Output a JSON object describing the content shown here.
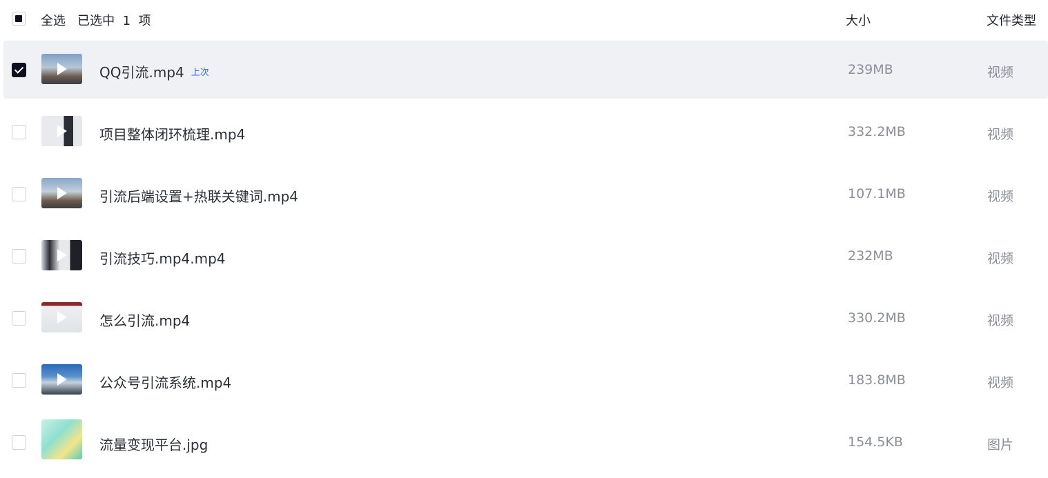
{
  "header": {
    "select_all_label": "全选   已选中  1  项",
    "size_column": "大小",
    "type_column": "文件类型"
  },
  "files": [
    {
      "name": "QQ引流.mp4",
      "tag": "上次",
      "size": "239MB",
      "type": "视频",
      "selected": true,
      "thumb_icon": "video-thumbnail"
    },
    {
      "name": "项目整体闭环梳理.mp4",
      "size": "332.2MB",
      "type": "视频",
      "selected": false,
      "thumb_icon": "video-thumbnail"
    },
    {
      "name": "引流后端设置+热联关键词.mp4",
      "size": "107.1MB",
      "type": "视频",
      "selected": false,
      "thumb_icon": "video-thumbnail"
    },
    {
      "name": "引流技巧.mp4.mp4",
      "size": "232MB",
      "type": "视频",
      "selected": false,
      "thumb_icon": "video-thumbnail"
    },
    {
      "name": "怎么引流.mp4",
      "size": "330.2MB",
      "type": "视频",
      "selected": false,
      "thumb_icon": "video-thumbnail"
    },
    {
      "name": "公众号引流系统.mp4",
      "size": "183.8MB",
      "type": "视频",
      "selected": false,
      "thumb_icon": "video-thumbnail"
    },
    {
      "name": "流量变现平台.jpg",
      "size": "154.5KB",
      "type": "图片",
      "selected": false,
      "thumb_icon": "image-thumbnail"
    }
  ],
  "colors": {
    "selected_row_bg": "#f0f1f4",
    "tag_color": "#2f6bf3",
    "checkbox_checked": "#0d1020"
  }
}
